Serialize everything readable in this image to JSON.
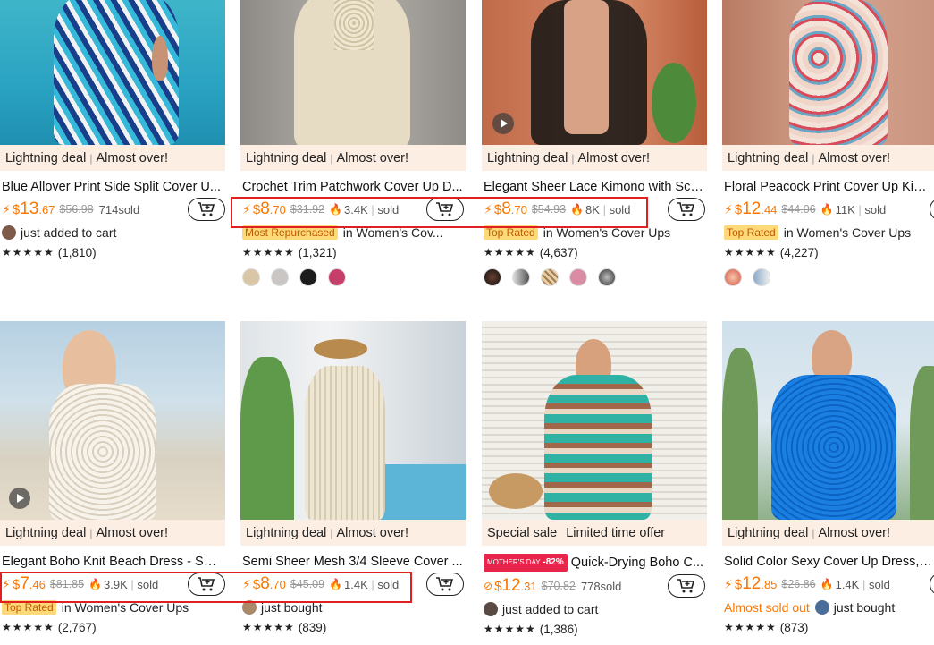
{
  "cart_label": "Add to cart",
  "products": [
    {
      "deal": "Lightning deal",
      "deal2": "Almost over!",
      "title": "Blue Allover Print Side Split Cover U...",
      "cur": "$",
      "whole": "13",
      "dec": ".67",
      "orig": "$56.98",
      "sold": "714sold",
      "meta_text": "just added to cart",
      "rating": "(1,810)"
    },
    {
      "deal": "Lightning deal",
      "deal2": "Almost over!",
      "title": "Crochet Trim Patchwork Cover Up D...",
      "cur": "$",
      "whole": "8",
      "dec": ".70",
      "orig": "$31.92",
      "sold": "3.4K",
      "sold_suffix": "sold",
      "badge": "Most Repurchased",
      "meta_text": "in Women's Cov...",
      "rating": "(1,321)"
    },
    {
      "deal": "Lightning deal",
      "deal2": "Almost over!",
      "title": "Elegant Sheer Lace Kimono with Sca...",
      "cur": "$",
      "whole": "8",
      "dec": ".70",
      "orig": "$54.93",
      "sold": "8K",
      "sold_suffix": "sold",
      "badge": "Top Rated",
      "meta_text": "in Women's Cover Ups",
      "rating": "(4,637)"
    },
    {
      "deal": "Lightning deal",
      "deal2": "Almost over!",
      "title": "Floral Peacock Print Cover Up Kimo...",
      "cur": "$",
      "whole": "12",
      "dec": ".44",
      "orig": "$44.06",
      "sold": "11K",
      "sold_suffix": "sold",
      "badge": "Top Rated",
      "meta_text": "in Women's Cover Ups",
      "rating": "(4,227)"
    },
    {
      "deal": "Lightning deal",
      "deal2": "Almost over!",
      "title": "Elegant Boho Knit Beach Dress - Se...",
      "cur": "$",
      "whole": "7",
      "dec": ".46",
      "orig": "$81.85",
      "sold": "3.9K",
      "sold_suffix": "sold",
      "badge": "Top Rated",
      "meta_text": "in Women's Cover Ups",
      "rating": "(2,767)"
    },
    {
      "deal": "Lightning deal",
      "deal2": "Almost over!",
      "title": "Semi Sheer Mesh 3/4 Sleeve Cover ...",
      "cur": "$",
      "whole": "8",
      "dec": ".70",
      "orig": "$45.09",
      "sold": "1.4K",
      "sold_suffix": "sold",
      "meta_text": "just bought",
      "rating": "(839)"
    },
    {
      "deal": "Special sale",
      "deal2": "Limited time offer",
      "title": "Quick-Drying Boho C...",
      "promo": "MOTHER'S DAY",
      "discount": "-82%",
      "cur": "$",
      "whole": "12",
      "dec": ".31",
      "orig": "$70.82",
      "sold": "778sold",
      "meta_text": "just added to cart",
      "rating": "(1,386)"
    },
    {
      "deal": "Lightning deal",
      "deal2": "Almost over!",
      "title": "Solid Color Sexy Cover Up Dress, V ...",
      "cur": "$",
      "whole": "12",
      "dec": ".85",
      "orig": "$26.86",
      "sold": "1.4K",
      "sold_suffix": "sold",
      "almost": "Almost sold out",
      "meta_text": "just bought",
      "rating": "(873)"
    }
  ],
  "stars": "★★★★★",
  "colors": {
    "accent": "#fb7701",
    "deal_bg": "#fdeee4",
    "highlight": "#e02020"
  }
}
